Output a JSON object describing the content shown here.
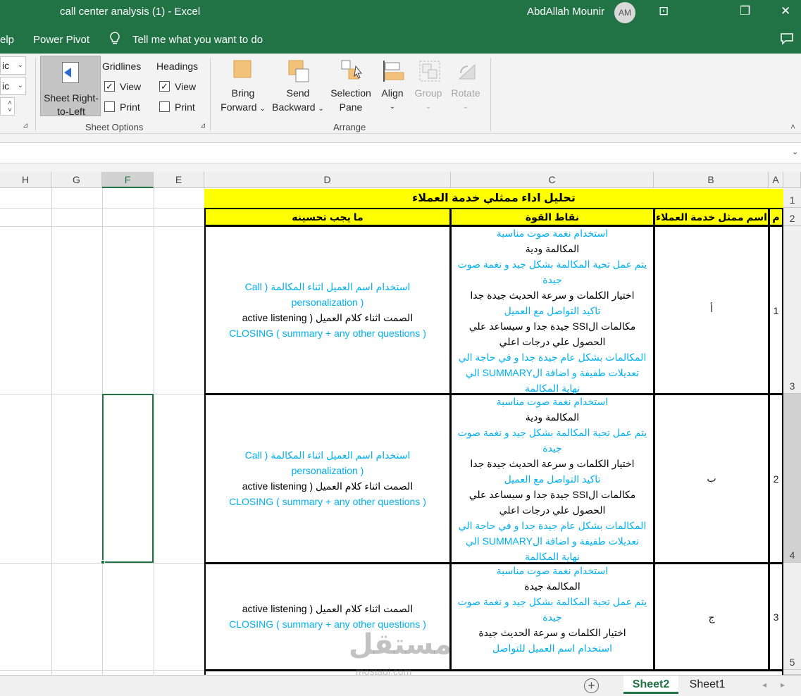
{
  "window": {
    "title": "call center analysis (1)  -  Excel",
    "user": "AbdAllah Mounir",
    "avatar": "AM",
    "minimize_icon": "⊡",
    "restore_icon": "❐",
    "close_icon": "✕"
  },
  "ribbon_tabs": {
    "help": "elp",
    "power_pivot": "Power Pivot",
    "tell_me": "Tell me what you want to do"
  },
  "ribbon": {
    "sel1": "ic",
    "sel2": "ic",
    "sheet_rtl_line1": "Sheet Right-",
    "sheet_rtl_line2": "to-Left",
    "gridlines": "Gridlines",
    "gridlines_view": "View",
    "gridlines_print": "Print",
    "headings": "Headings",
    "headings_view": "View",
    "headings_print": "Print",
    "sheet_options": "Sheet Options",
    "bring_forward_1": "Bring",
    "bring_forward_2": "Forward",
    "send_backward_1": "Send",
    "send_backward_2": "Backward",
    "selection_pane_1": "Selection",
    "selection_pane_2": "Pane",
    "align": "Align",
    "group": "Group",
    "rotate": "Rotate",
    "arrange": "Arrange"
  },
  "columns": [
    "H",
    "G",
    "F",
    "E",
    "D",
    "C",
    "B",
    "A"
  ],
  "rows": [
    "1",
    "2",
    "3",
    "4",
    "5"
  ],
  "sheet": {
    "title": "تحليل اداء ممثلي خدمة العملاء",
    "headers": {
      "num": "م",
      "name": "اسم ممثل خدمة العملاء",
      "strengths": "نقاط القوة",
      "improve": "ما يجب تحسينه"
    },
    "records": [
      {
        "num": "1",
        "name": "أ",
        "strengths": [
          {
            "t": "استخدام نغمة صوت مناسبة",
            "c": "b"
          },
          {
            "t": "المكالمة ودية",
            "c": "k"
          },
          {
            "t": "يتم عمل تحية المكالمة بشكل جيد و نغمة صوت",
            "c": "b"
          },
          {
            "t": "جيدة",
            "c": "b"
          },
          {
            "t": "اختيار الكلمات و سرعة الحديث جيدة جدا",
            "c": "k"
          },
          {
            "t": "تاكيد التواصل مع العميل",
            "c": "b"
          },
          {
            "t": "مكالمات الSSI  جيدة جدا و سيساعد علي",
            "c": "k"
          },
          {
            "t": "الحصول علي درجات اعلي",
            "c": "k"
          },
          {
            "t": "المكالمات بشكل عام جيدة جدا و في حاجة الي",
            "c": "b"
          },
          {
            "t": "تعديلات طفيفة  و اضافة الSUMMARY  الي",
            "c": "b"
          },
          {
            "t": "نهاية المكالمة",
            "c": "b"
          }
        ],
        "improve": [
          {
            "t": "استخدام اسم العميل اثناء المكالمة ( Call",
            "c": "b"
          },
          {
            "t": "( personalization",
            "c": "b"
          },
          {
            "t": "الصمت اثناء كلام العميل ( active listening",
            "c": "k"
          },
          {
            "t": "CLOSING ( summary + any other questions )",
            "c": "b"
          }
        ]
      },
      {
        "num": "2",
        "name": "ب",
        "strengths": [
          {
            "t": "استخدام نغمة صوت مناسبة",
            "c": "b"
          },
          {
            "t": "المكالمة ودية",
            "c": "k"
          },
          {
            "t": "يتم عمل تحية المكالمة بشكل جيد و نغمة صوت",
            "c": "b"
          },
          {
            "t": "جيدة",
            "c": "b"
          },
          {
            "t": "اختيار الكلمات و سرعة الحديث جيدة جدا",
            "c": "k"
          },
          {
            "t": "تاكيد التواصل مع العميل",
            "c": "b"
          },
          {
            "t": "مكالمات الSSI  جيدة جدا و سيساعد علي",
            "c": "k"
          },
          {
            "t": "الحصول علي درجات اعلي",
            "c": "k"
          },
          {
            "t": "المكالمات بشكل عام جيدة جدا و في حاجة الي",
            "c": "b"
          },
          {
            "t": "تعديلات طفيفة  و اضافة الSUMMARY  الي",
            "c": "b"
          },
          {
            "t": "نهاية المكالمة",
            "c": "b"
          }
        ],
        "improve": [
          {
            "t": "استخدام اسم العميل اثناء المكالمة ( Call",
            "c": "b"
          },
          {
            "t": "( personalization",
            "c": "b"
          },
          {
            "t": "الصمت اثناء كلام العميل ( active listening",
            "c": "k"
          },
          {
            "t": "CLOSING ( summary + any other questions )",
            "c": "b"
          }
        ]
      },
      {
        "num": "3",
        "name": "ج",
        "strengths": [
          {
            "t": "استخدام نغمة صوت مناسبة",
            "c": "b"
          },
          {
            "t": "المكالمة جيدة",
            "c": "k"
          },
          {
            "t": "يتم عمل تحية المكالمة بشكل جيد و نغمة صوت",
            "c": "b"
          },
          {
            "t": "جيدة",
            "c": "b"
          },
          {
            "t": "اختيار الكلمات و سرعة الحديث جيدة",
            "c": "k"
          },
          {
            "t": "استخدام  اسم العميل للتواصل",
            "c": "b"
          }
        ],
        "improve": [
          {
            "t": "الصمت اثناء كلام العميل ( active listening",
            "c": "k"
          },
          {
            "t": "CLOSING ( summary + any other questions )",
            "c": "b"
          }
        ]
      }
    ]
  },
  "sheet_tabs": {
    "add_icon": "+",
    "active": "Sheet2",
    "other": "Sheet1"
  },
  "watermark": {
    "main": "مستقل",
    "sub": "mostaql.com"
  },
  "colors": {
    "excel_green": "#217346",
    "highlight_yellow": "#ffff00",
    "text_blue": "#00b0f0"
  }
}
